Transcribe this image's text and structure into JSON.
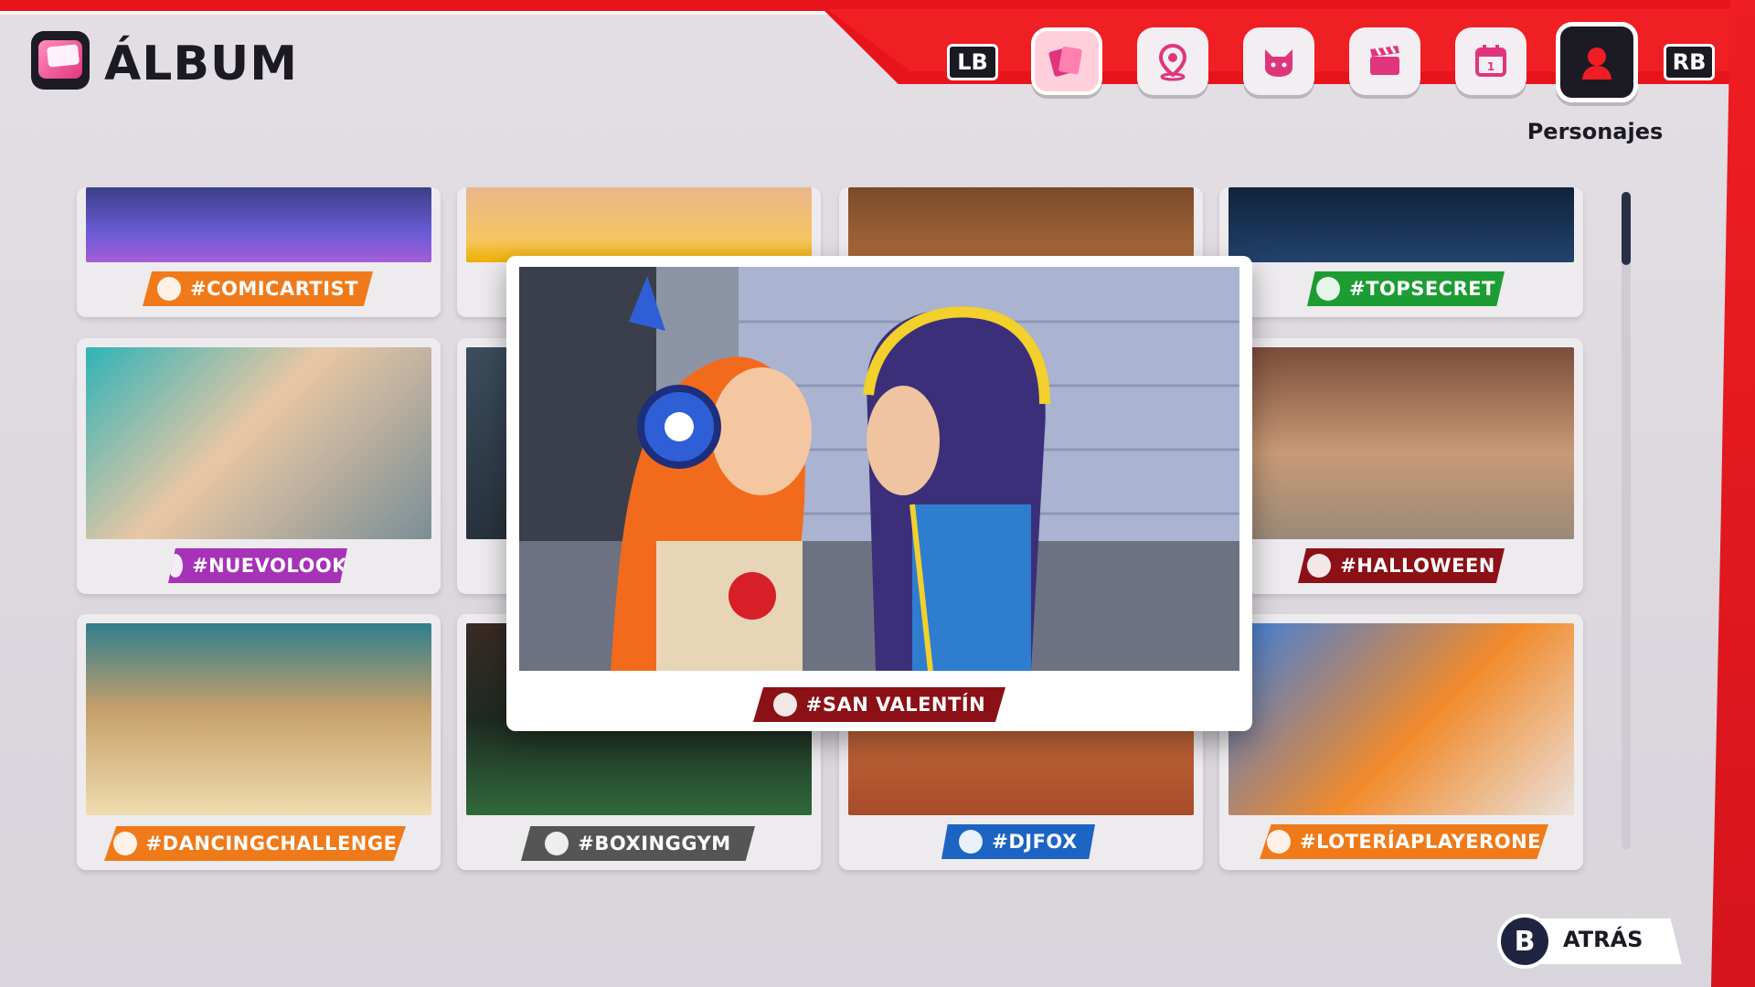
{
  "header": {
    "title": "ÁLBUM"
  },
  "nav": {
    "left_bumper": "LB",
    "right_bumper": "RB",
    "items": [
      {
        "icon": "cards-icon",
        "active": true
      },
      {
        "icon": "map-pin-icon"
      },
      {
        "icon": "pet-icon"
      },
      {
        "icon": "clapperboard-icon"
      },
      {
        "icon": "calendar-icon"
      },
      {
        "icon": "person-icon",
        "selected": true
      }
    ],
    "selected_label": "Personajes"
  },
  "featured": {
    "tag": "#SAN VALENTÍN",
    "tag_color": "#8b1116",
    "icon": "calendar-icon"
  },
  "cards": [
    {
      "tag": "#COMICARTIST",
      "color": "#f07a1a",
      "icon": "sticker-icon"
    },
    {
      "tag": "",
      "color": "#f07a1a",
      "icon": ""
    },
    {
      "tag": "",
      "color": "#f07a1a",
      "icon": ""
    },
    {
      "tag": "#TOPSECRET",
      "color": "#1d9c33",
      "icon": "sticker-icon"
    },
    {
      "tag": "#NUEVOLOOK",
      "color": "#a632b8",
      "icon": "brush-icon"
    },
    {
      "tag": "#HALLOWEEN",
      "color": "#8b1116",
      "icon": "calendar-icon"
    },
    {
      "tag": "#DANCINGCHALLENGE",
      "color": "#f07a1a",
      "icon": "chart-icon"
    },
    {
      "tag": "#BOXINGGYM",
      "color": "#555555",
      "icon": "map-pin-icon"
    },
    {
      "tag": "#DJFOX",
      "color": "#1c64c4",
      "icon": "person-icon"
    },
    {
      "tag": "#LOTERÍAPLAYERONE",
      "color": "#f07a1a",
      "icon": "sticker-icon"
    }
  ],
  "footer": {
    "back_button": "B",
    "back_label": "ATRÁS"
  }
}
